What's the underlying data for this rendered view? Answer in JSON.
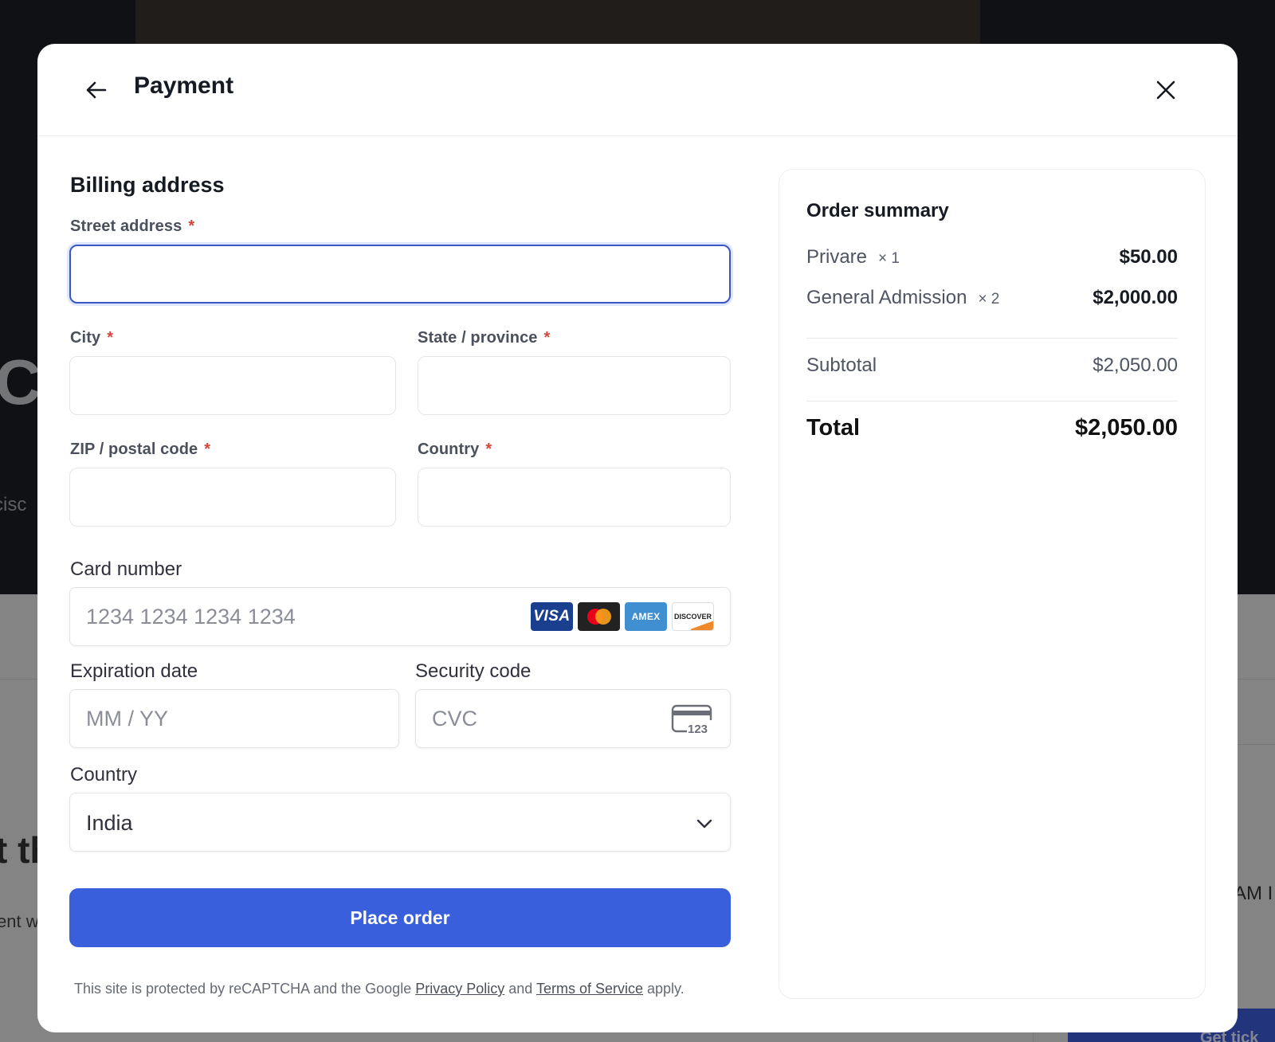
{
  "background": {
    "hero_fragment": "C",
    "sub_fragment": "cisc",
    "heading_fragment": "t th",
    "text_fragment": "ent w",
    "time_fragment": "AM I",
    "button_fragment": "Get tick"
  },
  "header": {
    "title": "Payment",
    "back_icon": "arrow-left-icon",
    "close_icon": "close-icon"
  },
  "billing": {
    "title": "Billing address",
    "required_mark": "*",
    "street": {
      "label": "Street address",
      "value": ""
    },
    "city": {
      "label": "City",
      "value": ""
    },
    "state": {
      "label": "State / province",
      "value": ""
    },
    "zip": {
      "label": "ZIP / postal code",
      "value": ""
    },
    "country": {
      "label": "Country",
      "value": ""
    }
  },
  "card": {
    "number_label": "Card number",
    "number_placeholder": "1234 1234 1234 1234",
    "brands": {
      "visa": "VISA",
      "mastercard": "",
      "amex": "AMEX",
      "discover": "DISCOVER"
    },
    "expiry_label": "Expiration date",
    "expiry_placeholder": "MM / YY",
    "cvc_label": "Security code",
    "cvc_placeholder": "CVC",
    "cvc_icon_text": "123",
    "country_label": "Country",
    "country_value": "India"
  },
  "actions": {
    "place_order_label": "Place order"
  },
  "legal": {
    "prefix": "This site is protected by reCAPTCHA and the Google ",
    "privacy_link": "Privacy Policy",
    "and": " and ",
    "terms_link": "Terms of Service",
    "suffix": " apply."
  },
  "summary": {
    "title": "Order summary",
    "items": [
      {
        "name": "Privare",
        "qty": "× 1",
        "price": "$50.00"
      },
      {
        "name": "General Admission",
        "qty": "× 2",
        "price": "$2,000.00"
      }
    ],
    "subtotal_label": "Subtotal",
    "subtotal_value": "$2,050.00",
    "total_label": "Total",
    "total_value": "$2,050.00"
  },
  "colors": {
    "primary": "#3a5fdc",
    "focus_border": "#3a56c6",
    "required": "#d6443b",
    "visa": "#1a3f8f",
    "amex": "#3f8fd1",
    "mastercard_red": "#eb001b",
    "mastercard_orange": "#f79e1b"
  }
}
